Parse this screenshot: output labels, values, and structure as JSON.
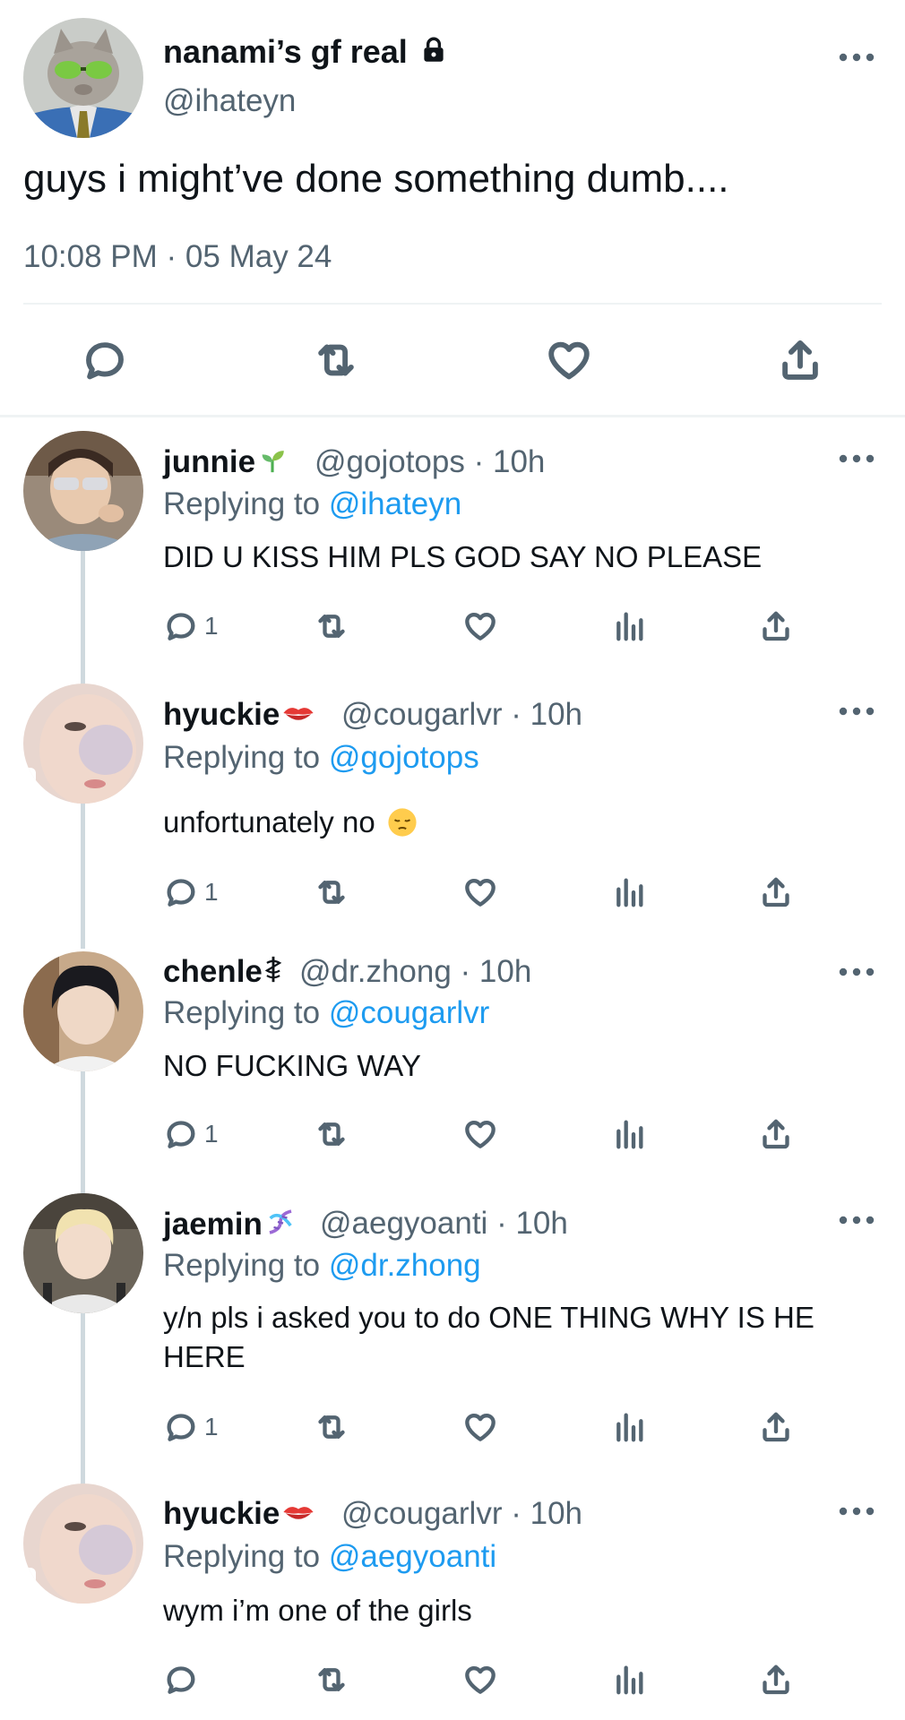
{
  "main_tweet": {
    "display_name": "nanami’s gf real",
    "lock_icon": "lock-icon",
    "handle": "@ihateyn",
    "text": "guys i might’ve done something dumb....",
    "timestamp": "10:08 PM · 05 May 24",
    "actions": [
      "reply-icon",
      "retweet-icon",
      "like-icon",
      "share-icon"
    ]
  },
  "replies": [
    {
      "display_name": "junnie",
      "badge_icon": "sprout-emoji",
      "handle": "@gojotops",
      "time": "· 10h",
      "replying_prefix": "Replying to",
      "replying_to": "@ihateyn",
      "text": "DID U KISS HIM PLS GOD SAY NO PLEASE",
      "reply_count": "1"
    },
    {
      "display_name": "hyuckie",
      "badge_icon": "kiss-mark-emoji",
      "handle": "@cougarlvr",
      "time": "· 10h",
      "replying_prefix": "Replying to",
      "replying_to": "@gojotops",
      "text": "unfortunately no",
      "text_emoji": "pensive-face-emoji",
      "reply_count": "1"
    },
    {
      "display_name": "chenle",
      "badge_icon": "medical-symbol",
      "handle": "@dr.zhong",
      "time": "· 10h",
      "replying_prefix": "Replying to",
      "replying_to": "@cougarlvr",
      "text": "NO FUCKING WAY",
      "reply_count": "1"
    },
    {
      "display_name": "jaemin",
      "badge_icon": "dna-emoji",
      "handle": "@aegyoanti",
      "time": "· 10h",
      "replying_prefix": "Replying to",
      "replying_to": "@dr.zhong",
      "text": "y/n pls i asked you to do ONE THING WHY IS HE HERE",
      "reply_count": "1"
    },
    {
      "display_name": "hyuckie",
      "badge_icon": "kiss-mark-emoji",
      "handle": "@cougarlvr",
      "time": "· 10h",
      "replying_prefix": "Replying to",
      "replying_to": "@aegyoanti",
      "text": "wym i’m one of the girls",
      "reply_count": ""
    }
  ],
  "colors": {
    "link": "#1d9bf0",
    "secondary_text": "#536471",
    "thread_line": "#cfd9de",
    "divider": "#eff3f4"
  }
}
